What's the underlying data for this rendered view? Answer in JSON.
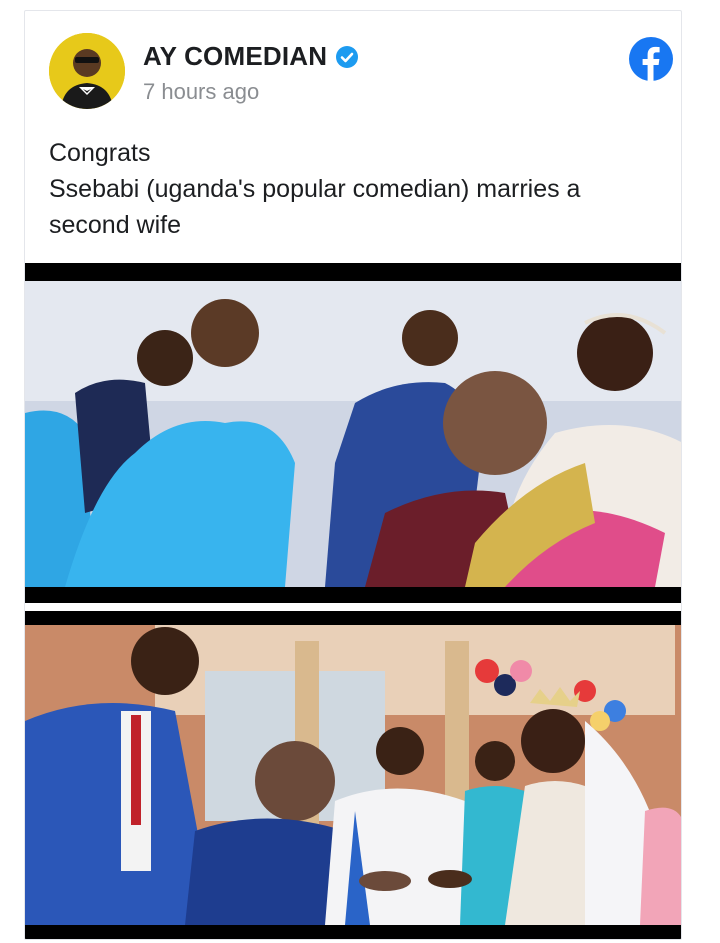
{
  "post": {
    "author_name": "AY COMEDIAN",
    "timestamp": "7 hours ago",
    "text_lines": [
      "Congrats",
      "Ssebabi (uganda's popular comedian) marries a second wife"
    ]
  },
  "icons": {
    "verified": "verified-badge-icon",
    "platform": "facebook-logo-icon",
    "avatar": "profile-avatar"
  },
  "colors": {
    "facebook_blue": "#1877f2",
    "verified_blue": "#1d9bf0",
    "avatar_bg": "#e7c91a"
  },
  "photos": [
    {
      "name": "wedding-photo-1"
    },
    {
      "name": "wedding-photo-2"
    }
  ]
}
